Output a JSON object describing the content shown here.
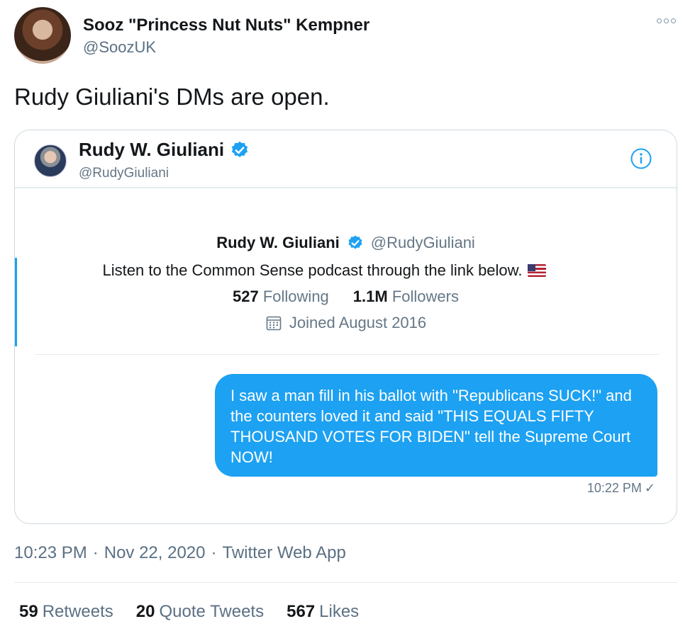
{
  "author": {
    "name": "Sooz \"Princess Nut Nuts\" Kempner",
    "handle": "@SoozUK"
  },
  "tweet": {
    "text": "Rudy Giuliani's DMs are open.",
    "time": "10:23 PM",
    "date": "Nov 22, 2020",
    "source": "Twitter Web App",
    "separator": "·"
  },
  "embed": {
    "header": {
      "name": "Rudy W. Giuliani",
      "handle": "@RudyGiuliani"
    },
    "profile": {
      "name": "Rudy W. Giuliani",
      "handle": "@RudyGiuliani",
      "bio": "Listen to the Common Sense podcast through the link below.",
      "following_count": "527",
      "following_label": "Following",
      "followers_count": "1.1M",
      "followers_label": "Followers",
      "joined": "Joined August 2016"
    },
    "message": {
      "text": "I saw a man fill in his ballot with \"Republicans SUCK!\" and the counters loved it and said \"THIS EQUALS FIFTY THOUSAND VOTES FOR BIDEN\" tell the Supreme Court NOW!",
      "time": "10:22 PM",
      "status_mark": "✓"
    }
  },
  "stats": {
    "retweets_count": "59",
    "retweets_label": "Retweets",
    "quotes_count": "20",
    "quotes_label": "Quote Tweets",
    "likes_count": "567",
    "likes_label": "Likes"
  },
  "colors": {
    "accent": "#1da1f2",
    "muted": "#5b7083",
    "text": "#14171a"
  },
  "icons": [
    "more-icon",
    "verified-icon",
    "info-icon",
    "us-flag-icon",
    "calendar-icon",
    "check-icon"
  ]
}
